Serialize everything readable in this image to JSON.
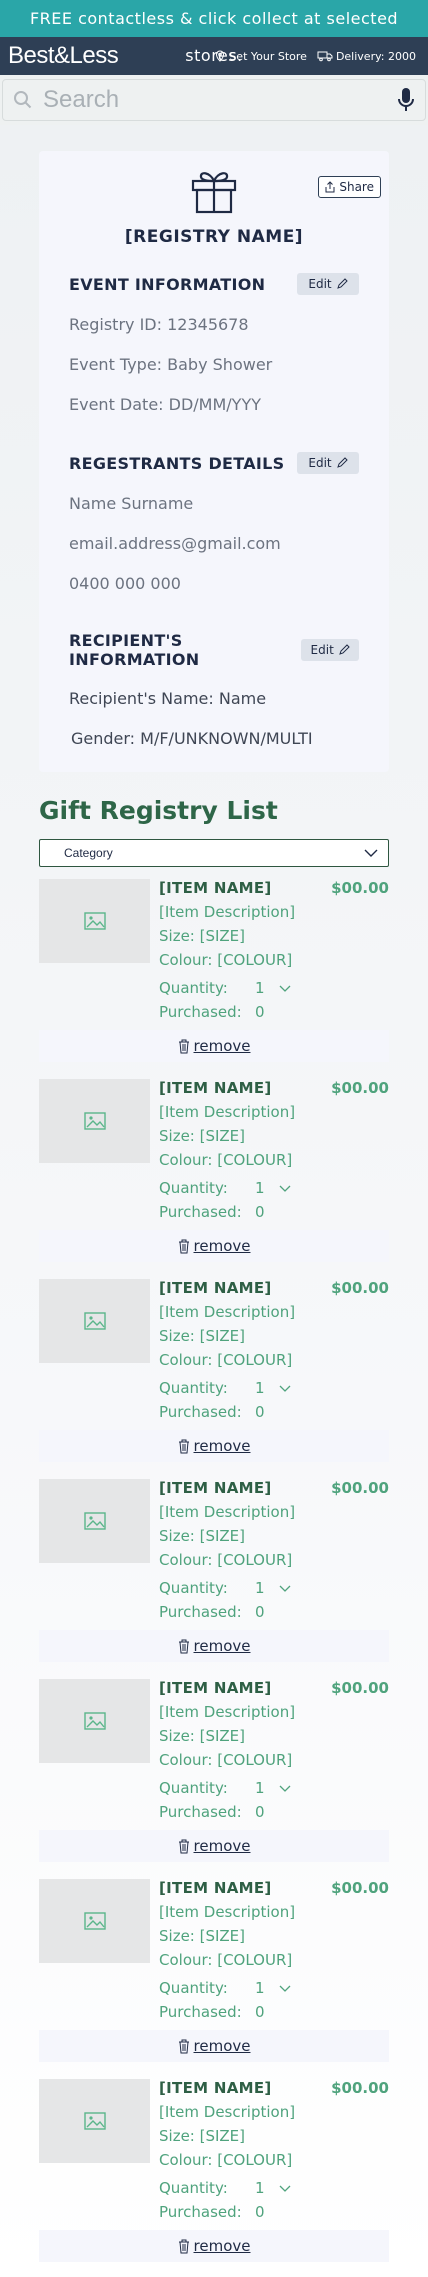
{
  "promo": {
    "text": "FREE contactless & click collect at selected stores."
  },
  "nav": {
    "logo": "Best&Less",
    "store_label": "Set Your Store",
    "delivery_label": "Delivery: 2000"
  },
  "search": {
    "placeholder": "Search"
  },
  "registry": {
    "name": "[REGISTRY NAME]",
    "share_label": "Share",
    "edit_label": "Edit",
    "event": {
      "title": "EVENT INFORMATION",
      "registry_id": "Registry ID: 12345678",
      "event_type": "Event Type: Baby Shower",
      "event_date": "Event Date: DD/MM/YYY"
    },
    "registrants": {
      "title": "REGESTRANTS DETAILS",
      "name": "Name Surname",
      "email": "email.address@gmail.com",
      "phone": "0400 000 000"
    },
    "recipient": {
      "title": "RECIPIENT'S INFORMATION",
      "name": "Recipient's Name: Name",
      "gender": "Gender: M/F/UNKNOWN/MULTI"
    }
  },
  "list": {
    "title": "Gift Registry List",
    "category_selected": "Category",
    "quantity_label": "Quantity:",
    "purchased_label": "Purchased:",
    "remove_label": "remove",
    "items": [
      {
        "name": "[ITEM NAME]",
        "price": "$00.00",
        "description": "[Item Description]",
        "size": "Size: [SIZE]",
        "colour": "Colour: [COLOUR]",
        "quantity": "1",
        "purchased": "0"
      },
      {
        "name": "[ITEM NAME]",
        "price": "$00.00",
        "description": "[Item Description]",
        "size": "Size: [SIZE]",
        "colour": "Colour: [COLOUR]",
        "quantity": "1",
        "purchased": "0"
      },
      {
        "name": "[ITEM NAME]",
        "price": "$00.00",
        "description": "[Item Description]",
        "size": "Size: [SIZE]",
        "colour": "Colour: [COLOUR]",
        "quantity": "1",
        "purchased": "0"
      },
      {
        "name": "[ITEM NAME]",
        "price": "$00.00",
        "description": "[Item Description]",
        "size": "Size: [SIZE]",
        "colour": "Colour: [COLOUR]",
        "quantity": "1",
        "purchased": "0"
      },
      {
        "name": "[ITEM NAME]",
        "price": "$00.00",
        "description": "[Item Description]",
        "size": "Size: [SIZE]",
        "colour": "Colour: [COLOUR]",
        "quantity": "1",
        "purchased": "0"
      },
      {
        "name": "[ITEM NAME]",
        "price": "$00.00",
        "description": "[Item Description]",
        "size": "Size: [SIZE]",
        "colour": "Colour: [COLOUR]",
        "quantity": "1",
        "purchased": "0"
      },
      {
        "name": "[ITEM NAME]",
        "price": "$00.00",
        "description": "[Item Description]",
        "size": "Size: [SIZE]",
        "colour": "Colour: [COLOUR]",
        "quantity": "1",
        "purchased": "0"
      }
    ],
    "peek_item": {
      "name": "[ITEM NAME]"
    }
  },
  "colors": {
    "promo_bg": "#2aa6a8",
    "nav_bg": "#2e3f55",
    "accent_green": "#4fa37d",
    "heading_green": "#2e6648",
    "navy_text": "#1f2a44"
  },
  "icons": [
    "location-pin-icon",
    "truck-icon",
    "search-icon",
    "microphone-icon",
    "gift-icon",
    "share-icon",
    "pencil-icon",
    "chevron-down-icon",
    "image-placeholder-icon",
    "trash-icon"
  ]
}
